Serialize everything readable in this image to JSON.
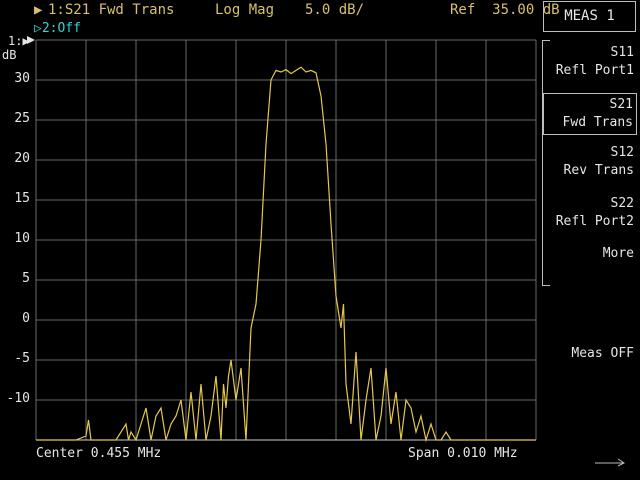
{
  "header": {
    "trace1_indicator": "▶",
    "trace1_param": "1:S21 Fwd Trans",
    "format": "Log Mag",
    "scale": "5.0 dB/",
    "ref": "Ref  35.00 dB",
    "trace2": "▷2:Off"
  },
  "plot": {
    "channel_marker": "1:▶",
    "unit": "dB",
    "y_tick_labels": [
      "30",
      "25",
      "20",
      "15",
      "10",
      "5",
      "0",
      "-5",
      "-10"
    ],
    "center": "Center 0.455 MHz",
    "span": "Span 0.010 MHz",
    "trace_color": "#e6c84a",
    "grid_color": "#6a6a6a"
  },
  "menu": {
    "title": "MEAS 1",
    "s11": "S11\nRefl Port1",
    "s21": "S21\nFwd Trans",
    "s12": "S12\nRev Trans",
    "s22": "S22\nRefl Port2",
    "more": "More",
    "meas_off": "Meas OFF"
  },
  "chart_data": {
    "type": "line",
    "ylim": [
      -15,
      35
    ],
    "x_divisions": 10,
    "y_divisions": 10,
    "series": [
      {
        "x": [
          0,
          0.04,
          0.08,
          0.1,
          0.105,
          0.11,
          0.16,
          0.18,
          0.185,
          0.19,
          0.2,
          0.22,
          0.23,
          0.24,
          0.25,
          0.26,
          0.27,
          0.28,
          0.29,
          0.3,
          0.31,
          0.32,
          0.33,
          0.34,
          0.35,
          0.36,
          0.37,
          0.375,
          0.38,
          0.385,
          0.39,
          0.4,
          0.41,
          0.42,
          0.43,
          0.44,
          0.45,
          0.46,
          0.47,
          0.48,
          0.49,
          0.5,
          0.51,
          0.52,
          0.53,
          0.54,
          0.55,
          0.56,
          0.57,
          0.58,
          0.59,
          0.6,
          0.61,
          0.615,
          0.62,
          0.63,
          0.64,
          0.65,
          0.66,
          0.67,
          0.68,
          0.69,
          0.7,
          0.71,
          0.72,
          0.73,
          0.74,
          0.75,
          0.76,
          0.77,
          0.78,
          0.79,
          0.8,
          0.81,
          0.82,
          0.83,
          0.84,
          0.85,
          0.9,
          1.0
        ],
        "y": [
          -15,
          -15,
          -15,
          -14.5,
          -12.5,
          -15,
          -15,
          -13,
          -15,
          -14,
          -15,
          -11,
          -15,
          -12,
          -11,
          -15,
          -13,
          -12,
          -10,
          -15,
          -9,
          -15,
          -8,
          -15,
          -12,
          -7,
          -15,
          -8,
          -11,
          -7,
          -5,
          -10,
          -6,
          -15,
          -1,
          2,
          10,
          22,
          30,
          31.2,
          31,
          31.3,
          30.8,
          31.2,
          31.6,
          31,
          31.2,
          30.9,
          28,
          22,
          12,
          3,
          -1,
          2,
          -8,
          -13,
          -4,
          -15,
          -10,
          -6,
          -15,
          -12,
          -6,
          -13,
          -9,
          -15,
          -10,
          -11,
          -14,
          -12,
          -15,
          -13,
          -15,
          -15,
          -14,
          -15,
          -15,
          -15,
          -15,
          -15
        ]
      }
    ]
  }
}
